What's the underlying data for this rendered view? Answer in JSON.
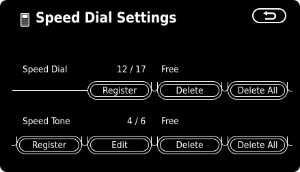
{
  "header": {
    "title": "Speed Dial Settings",
    "phone_icon": "phone-icon",
    "back_icon": "return-arrow-icon"
  },
  "speed_dial": {
    "label": "Speed Dial",
    "count": "12 / 17",
    "free_label": "Free",
    "buttons": {
      "register": "Register",
      "delete": "Delete",
      "delete_all": "Delete All"
    }
  },
  "speed_tone": {
    "label": "Speed Tone",
    "count": "4 / 6",
    "free_label": "Free",
    "buttons": {
      "register": "Register",
      "edit": "Edit",
      "delete": "Delete",
      "delete_all": "Delete All"
    }
  },
  "colors": {
    "background": "#000000",
    "foreground": "#ffffff",
    "frame": "#ffffff"
  }
}
